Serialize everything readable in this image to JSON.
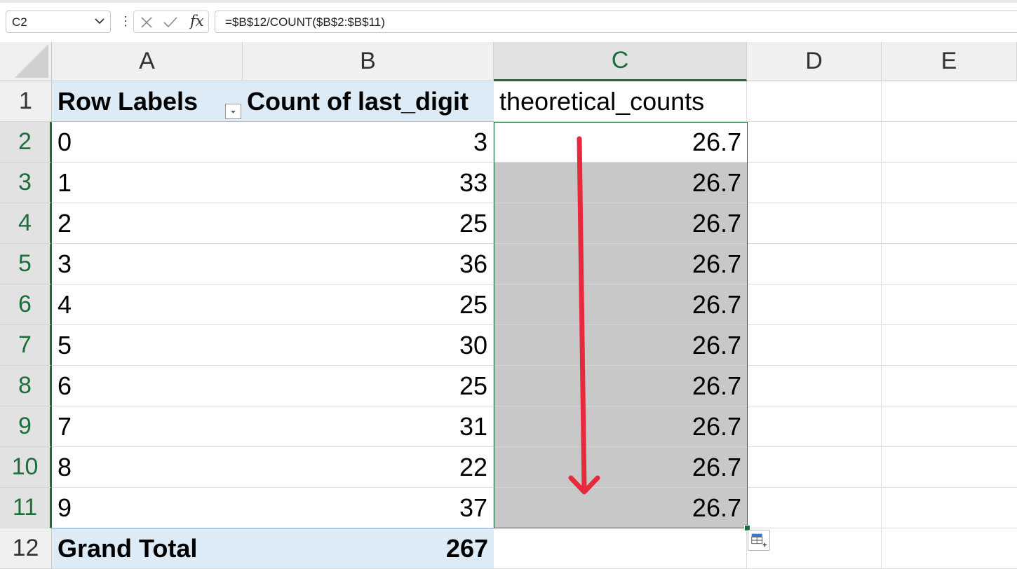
{
  "formula_bar": {
    "name_box": "C2",
    "formula": "=$B$12/COUNT($B$2:$B$11)",
    "fx_label": "fx",
    "dots": "⋮"
  },
  "columns": [
    "A",
    "B",
    "C",
    "D",
    "E"
  ],
  "rows": [
    "1",
    "2",
    "3",
    "4",
    "5",
    "6",
    "7",
    "8",
    "9",
    "10",
    "11",
    "12"
  ],
  "pivot": {
    "header_row_labels": "Row Labels",
    "header_count": "Count of last_digit",
    "rows": [
      {
        "label": "0",
        "count": "3"
      },
      {
        "label": "1",
        "count": "33"
      },
      {
        "label": "2",
        "count": "25"
      },
      {
        "label": "3",
        "count": "36"
      },
      {
        "label": "4",
        "count": "25"
      },
      {
        "label": "5",
        "count": "30"
      },
      {
        "label": "6",
        "count": "25"
      },
      {
        "label": "7",
        "count": "31"
      },
      {
        "label": "8",
        "count": "22"
      },
      {
        "label": "9",
        "count": "37"
      }
    ],
    "grand_total_label": "Grand Total",
    "grand_total_value": "267"
  },
  "theoretical": {
    "header": "theoretical_counts",
    "values": [
      "26.7",
      "26.7",
      "26.7",
      "26.7",
      "26.7",
      "26.7",
      "26.7",
      "26.7",
      "26.7",
      "26.7"
    ]
  },
  "colors": {
    "accent_green": "#1e6e3c",
    "pivot_fill": "#ddebf7",
    "selection_fill": "#c8c8c8",
    "annotation_arrow": "#e8283c"
  },
  "icons": {
    "cancel": "close-icon",
    "enter": "check-icon",
    "namebox_dropdown": "chevron-down-icon",
    "filter": "filter-dropdown-icon",
    "quick_analysis": "quick-analysis-icon",
    "annotation": "down-arrow-icon"
  }
}
